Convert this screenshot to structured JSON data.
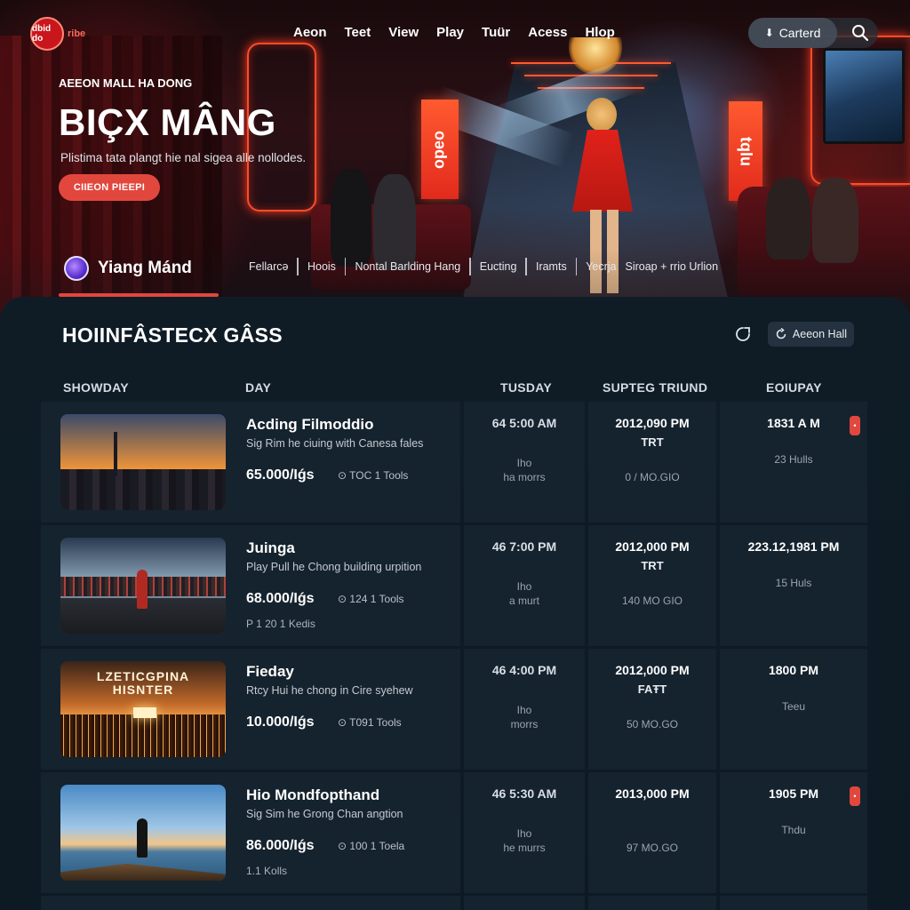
{
  "brand": {
    "logo_text": "dbid do",
    "logo_sub": "ribe"
  },
  "nav": [
    "Aeon",
    "Teet",
    "View",
    "Play",
    "Tuür",
    "Acess",
    "Hlop"
  ],
  "cart": {
    "label": "Carterd",
    "icon": "⬇"
  },
  "hero": {
    "kicker": "AEEON MALL HA DONG",
    "title": "BIÇX MÂNG",
    "subtitle": "Plistima tata plangt hie nal sigea alle nollodes.",
    "cta": "CIIEON PIEEPI",
    "poster1": "oədo",
    "poster2": "tqlu"
  },
  "venue": {
    "name": "Yiang Mánd"
  },
  "subnav": [
    "Fellarcə",
    "Hoois",
    "Nontal Barlding Hang",
    "Eucting",
    "Iramts",
    "Yecrja",
    "Siroap + rrio Urlion"
  ],
  "panel": {
    "title": "HOIINFÂSTECX GÂSS",
    "hall_button": "Aeeon Hall",
    "columns": [
      "SHOWDAY",
      "DAY",
      "TUSDAY",
      "SUPTEG TRIUND",
      "EOIUPAY"
    ]
  },
  "rows": [
    {
      "title": "Acding Filmoddio",
      "desc": "Sig Rim he ciuing with Canesa fales",
      "price": "65.000/Iǵs",
      "tools": "⊙ TOC 1 Tools",
      "extra": "",
      "time": "64 5:00 AM",
      "time_sub1": "Iho",
      "time_sub2": "ha morrs",
      "slot": "2012,090 PM",
      "slot_tag": "TRT",
      "slot_code": "0 / MO.GIO",
      "eq": "1831 A M",
      "eq_sub": "23 Hulls",
      "badge": true,
      "scene": "city"
    },
    {
      "title": "Juinga",
      "desc": "Play Pull he Chong building urpition",
      "price": "68.000/Iǵs",
      "tools": "⊙ 124 1 Tools",
      "extra": "P 1 20 1 Kedis",
      "time": "46 7:00 PM",
      "time_sub1": "Iho",
      "time_sub2": "a murt",
      "slot": "2012,000 PM",
      "slot_tag": "TRT",
      "slot_code": "140 MO GIO",
      "eq": "223.12,1981 PM",
      "eq_sub": "15 Huls",
      "badge": false,
      "scene": "crowd"
    },
    {
      "title": "Fieday",
      "desc": "Rtcy Hui he chong in Cire syehew",
      "price": "10.000/Iǵs",
      "tools": "⊙ T091 Tools",
      "extra": "",
      "time": "46 4:00 PM",
      "time_sub1": "Iho",
      "time_sub2": "morrs",
      "slot": "2012,000 PM",
      "slot_tag": "FAŦT",
      "slot_code": "50 MO.GO",
      "eq": "1800 PM",
      "eq_sub": "Teeu",
      "badge": false,
      "scene": "concert",
      "stage_title_1": "LZETICGPINA",
      "stage_title_2": "HISNTER"
    },
    {
      "title": "Hio Mondfopthand",
      "desc": "Sig Sim he Grong Chan angtion",
      "price": "86.000/Iǵs",
      "tools": "⊙ 100 1 Toela",
      "extra": "1.1 Kolls",
      "time": "46 5:30 AM",
      "time_sub1": "Iho",
      "time_sub2": "he murrs",
      "slot": "2013,000 PM",
      "slot_tag": "",
      "slot_code": "97 MO.GO",
      "eq": "1905 PM",
      "eq_sub": "Thdu",
      "badge": true,
      "scene": "beach"
    }
  ],
  "colors": {
    "accent": "#e2473e",
    "panel": "#0f1c26",
    "cell": "#15232e"
  },
  "icons": {
    "search": "search-icon",
    "share": "share-icon",
    "hall": "refresh-icon",
    "venue": "venue-logo-icon"
  }
}
